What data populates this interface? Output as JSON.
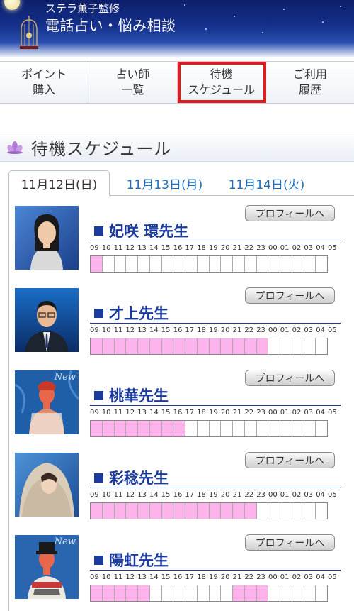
{
  "header": {
    "subtitle": "ステラ薫子監修",
    "title": "電話占い・悩み相談"
  },
  "nav": [
    {
      "label": "ポイント\n購入",
      "active": false
    },
    {
      "label": "占い師\n一覧",
      "active": false
    },
    {
      "label": "待機\nスケジュール",
      "active": true
    },
    {
      "label": "ご利用\n履歴",
      "active": false
    }
  ],
  "section": {
    "title": "待機スケジュール",
    "icon": "lotus-icon"
  },
  "tabs": [
    "11月12日(日)",
    "11月13日(月)",
    "11月14日(火)"
  ],
  "hours": [
    "09",
    "10",
    "11",
    "12",
    "13",
    "14",
    "15",
    "16",
    "17",
    "18",
    "19",
    "20",
    "21",
    "22",
    "23",
    "00",
    "01",
    "02",
    "03",
    "04",
    "05"
  ],
  "profile_button_label": "プロフィールへ",
  "new_label": "New",
  "colors": {
    "available": "#ffb3ec",
    "name": "#1a3a9c",
    "active_outline": "#e01c1c",
    "tab_link": "#1d6fbf"
  },
  "fortune_tellers": [
    {
      "name": "妃咲 環先生",
      "new": false,
      "available": [
        0
      ]
    },
    {
      "name": "才上先生",
      "new": false,
      "available": [
        0,
        1,
        2,
        3,
        4,
        5,
        6,
        7,
        8,
        9,
        10,
        11,
        12,
        13,
        14
      ]
    },
    {
      "name": "桃華先生",
      "new": true,
      "available": [
        0,
        1,
        2,
        3,
        4,
        5,
        6,
        7
      ]
    },
    {
      "name": "彩稔先生",
      "new": false,
      "available": [
        0,
        1,
        2,
        3,
        4,
        5,
        6,
        7,
        8,
        9,
        10,
        11,
        12,
        13
      ]
    },
    {
      "name": "陽虹先生",
      "new": true,
      "available": [
        0,
        1,
        2,
        3,
        4,
        12,
        13,
        14
      ]
    }
  ]
}
